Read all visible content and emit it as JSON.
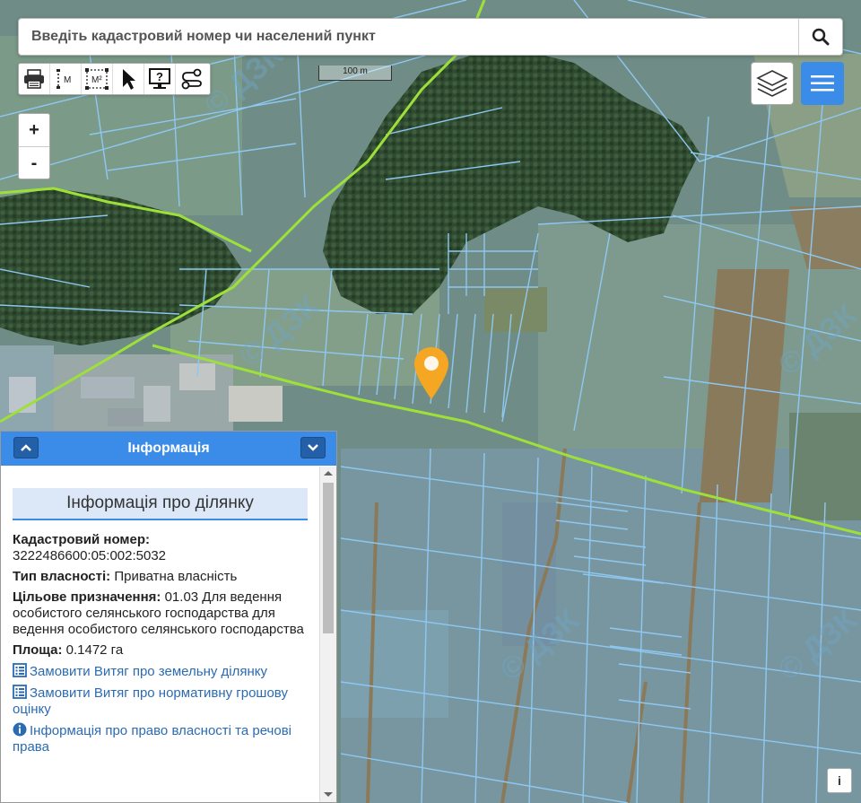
{
  "search": {
    "placeholder": "Введіть кадастровий номер чи населений пункт"
  },
  "toolbar": {
    "tools": [
      {
        "name": "print-tool",
        "icon": "printer-icon"
      },
      {
        "name": "measure-distance-tool",
        "icon": "ruler-icon",
        "label": "M"
      },
      {
        "name": "measure-area-tool",
        "icon": "area-icon",
        "label": "M²"
      },
      {
        "name": "select-tool",
        "icon": "cursor-icon"
      },
      {
        "name": "identify-tool",
        "icon": "help-monitor-icon"
      },
      {
        "name": "route-tool",
        "icon": "route-icon"
      }
    ]
  },
  "scale": {
    "label": "100 m"
  },
  "zoom": {
    "in_label": "+",
    "out_label": "-"
  },
  "map": {
    "watermark": "© ДЗК",
    "colors": {
      "parcel": "#8ec8f2",
      "road": "#9ee03a",
      "marker": "#f5a623",
      "accent": "#3b8ce8"
    }
  },
  "panel": {
    "header": "Інформація",
    "title": "Інформація про ділянку",
    "cadastral_label": "Кадастровий номер:",
    "cadastral_value": "3222486600:05:002:5032",
    "ownership_label": "Тип власності:",
    "ownership_value": "Приватна власність",
    "purpose_label": "Цільове призначення:",
    "purpose_value": "01.03 Для ведення особистого селянського господарства для ведення особистого селянського господарства",
    "area_label": "Площа:",
    "area_value": "0.1472 га",
    "links": [
      {
        "text": "Замовити Витяг про земельну ділянку",
        "icon": "list-icon"
      },
      {
        "text": "Замовити Витяг про нормативну грошову оцінку",
        "icon": "list-icon"
      },
      {
        "text": "Інформація про право власності та речові права",
        "icon": "info-icon"
      }
    ]
  },
  "attribution": {
    "label": "i"
  }
}
